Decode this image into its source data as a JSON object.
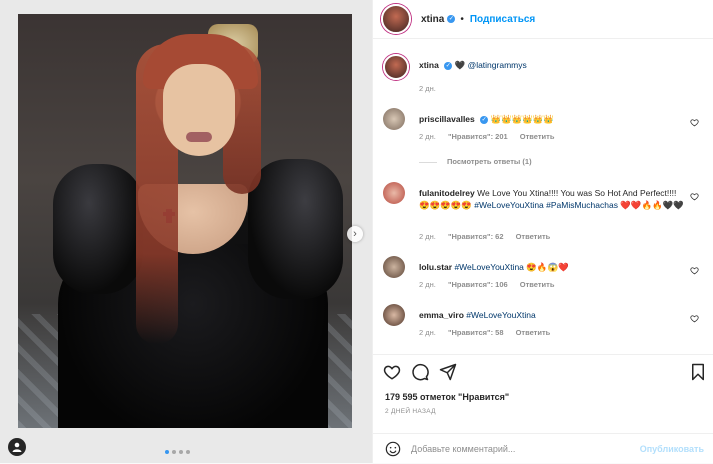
{
  "post": {
    "username": "xtina",
    "follow_label": "Подписаться",
    "separator": "•",
    "caption_tag": "@latingrammys",
    "caption_time": "2 дн.",
    "likes_count": "179 595 отметок \"Нравится\"",
    "date": "2 ДНЕЙ НАЗАД",
    "add_comment_placeholder": "Добавьте комментарий...",
    "publish_label": "Опубликовать",
    "carousel_dots": 4,
    "carousel_active": 0
  },
  "comments": [
    {
      "user": "priscillavalles",
      "text": "👑👑👑👑👑👑",
      "time": "2 дн.",
      "likes": "\"Нравится\": 201",
      "reply": "Ответить",
      "view_replies": "Посмотреть ответы (1)"
    },
    {
      "user": "fulanitodelrey",
      "text": "We Love You Xtina!!!! You was So Hot And Perfect!!!! 😍😍😍😍😍",
      "tag": "#WeLoveYouXtina #PaMisMuchachas",
      "emoji_tail": "❤️❤️🔥🔥🖤🖤",
      "time": "2 дн.",
      "likes": "\"Нравится\": 62",
      "reply": "Ответить"
    },
    {
      "user": "lolu.star",
      "tag": "#WeLoveYouXtina",
      "emoji_tail": "😍🔥😱❤️",
      "time": "2 дн.",
      "likes": "\"Нравится\": 106",
      "reply": "Ответить"
    },
    {
      "user": "emma_viro",
      "tag": "#WeLoveYouXtina",
      "time": "2 дн.",
      "likes": "\"Нравится\": 58",
      "reply": "Ответить"
    }
  ],
  "colors": {
    "accent": "#0095f6",
    "hashtag": "#00376b",
    "muted": "#8e8e8e"
  },
  "icons": [
    "heart-icon",
    "comment-icon",
    "share-icon",
    "bookmark-icon",
    "emoji-icon",
    "user-tag-icon",
    "chevron-right-icon",
    "verified-badge-icon"
  ]
}
